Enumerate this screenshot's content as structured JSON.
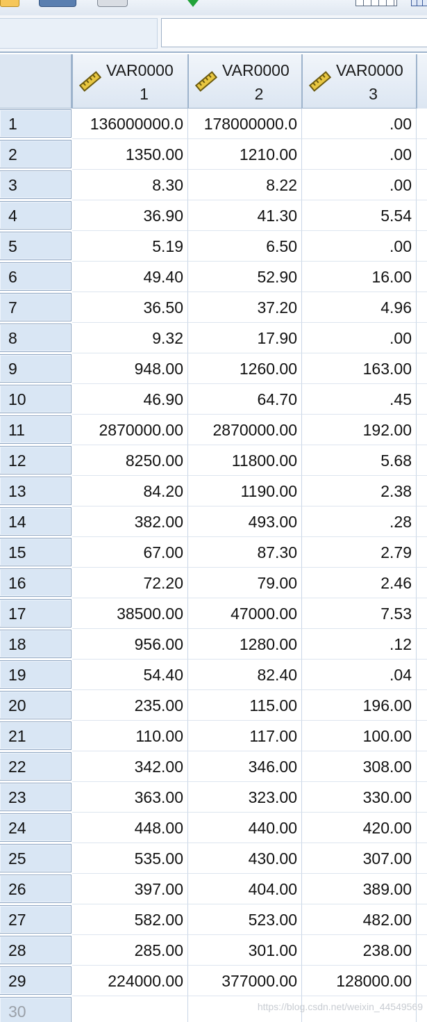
{
  "columns": [
    {
      "line1": "VAR0000",
      "line2": "1"
    },
    {
      "line1": "VAR0000",
      "line2": "2"
    },
    {
      "line1": "VAR0000",
      "line2": "3"
    }
  ],
  "rows": [
    {
      "n": "1",
      "v": [
        "136000000.0",
        "178000000.0",
        ".00"
      ]
    },
    {
      "n": "2",
      "v": [
        "1350.00",
        "1210.00",
        ".00"
      ]
    },
    {
      "n": "3",
      "v": [
        "8.30",
        "8.22",
        ".00"
      ]
    },
    {
      "n": "4",
      "v": [
        "36.90",
        "41.30",
        "5.54"
      ]
    },
    {
      "n": "5",
      "v": [
        "5.19",
        "6.50",
        ".00"
      ]
    },
    {
      "n": "6",
      "v": [
        "49.40",
        "52.90",
        "16.00"
      ]
    },
    {
      "n": "7",
      "v": [
        "36.50",
        "37.20",
        "4.96"
      ]
    },
    {
      "n": "8",
      "v": [
        "9.32",
        "17.90",
        ".00"
      ]
    },
    {
      "n": "9",
      "v": [
        "948.00",
        "1260.00",
        "163.00"
      ]
    },
    {
      "n": "10",
      "v": [
        "46.90",
        "64.70",
        ".45"
      ]
    },
    {
      "n": "11",
      "v": [
        "2870000.00",
        "2870000.00",
        "192.00"
      ]
    },
    {
      "n": "12",
      "v": [
        "8250.00",
        "11800.00",
        "5.68"
      ]
    },
    {
      "n": "13",
      "v": [
        "84.20",
        "1190.00",
        "2.38"
      ]
    },
    {
      "n": "14",
      "v": [
        "382.00",
        "493.00",
        ".28"
      ]
    },
    {
      "n": "15",
      "v": [
        "67.00",
        "87.30",
        "2.79"
      ]
    },
    {
      "n": "16",
      "v": [
        "72.20",
        "79.00",
        "2.46"
      ]
    },
    {
      "n": "17",
      "v": [
        "38500.00",
        "47000.00",
        "7.53"
      ]
    },
    {
      "n": "18",
      "v": [
        "956.00",
        "1280.00",
        ".12"
      ]
    },
    {
      "n": "19",
      "v": [
        "54.40",
        "82.40",
        ".04"
      ]
    },
    {
      "n": "20",
      "v": [
        "235.00",
        "115.00",
        "196.00"
      ]
    },
    {
      "n": "21",
      "v": [
        "110.00",
        "117.00",
        "100.00"
      ]
    },
    {
      "n": "22",
      "v": [
        "342.00",
        "346.00",
        "308.00"
      ]
    },
    {
      "n": "23",
      "v": [
        "363.00",
        "323.00",
        "330.00"
      ]
    },
    {
      "n": "24",
      "v": [
        "448.00",
        "440.00",
        "420.00"
      ]
    },
    {
      "n": "25",
      "v": [
        "535.00",
        "430.00",
        "307.00"
      ]
    },
    {
      "n": "26",
      "v": [
        "397.00",
        "404.00",
        "389.00"
      ]
    },
    {
      "n": "27",
      "v": [
        "582.00",
        "523.00",
        "482.00"
      ]
    },
    {
      "n": "28",
      "v": [
        "285.00",
        "301.00",
        "238.00"
      ]
    },
    {
      "n": "29",
      "v": [
        "224000.00",
        "377000.00",
        "128000.00"
      ]
    },
    {
      "n": "30",
      "v": [
        "",
        "",
        ""
      ]
    }
  ],
  "watermark": "https://blog.csdn.net/weixin_44549569",
  "icons": {
    "toolbar": [
      "open-folder-icon",
      "save-icon",
      "print-icon",
      "check-icon",
      "grid-icon",
      "table-icon"
    ],
    "column_type": "ruler-icon"
  }
}
